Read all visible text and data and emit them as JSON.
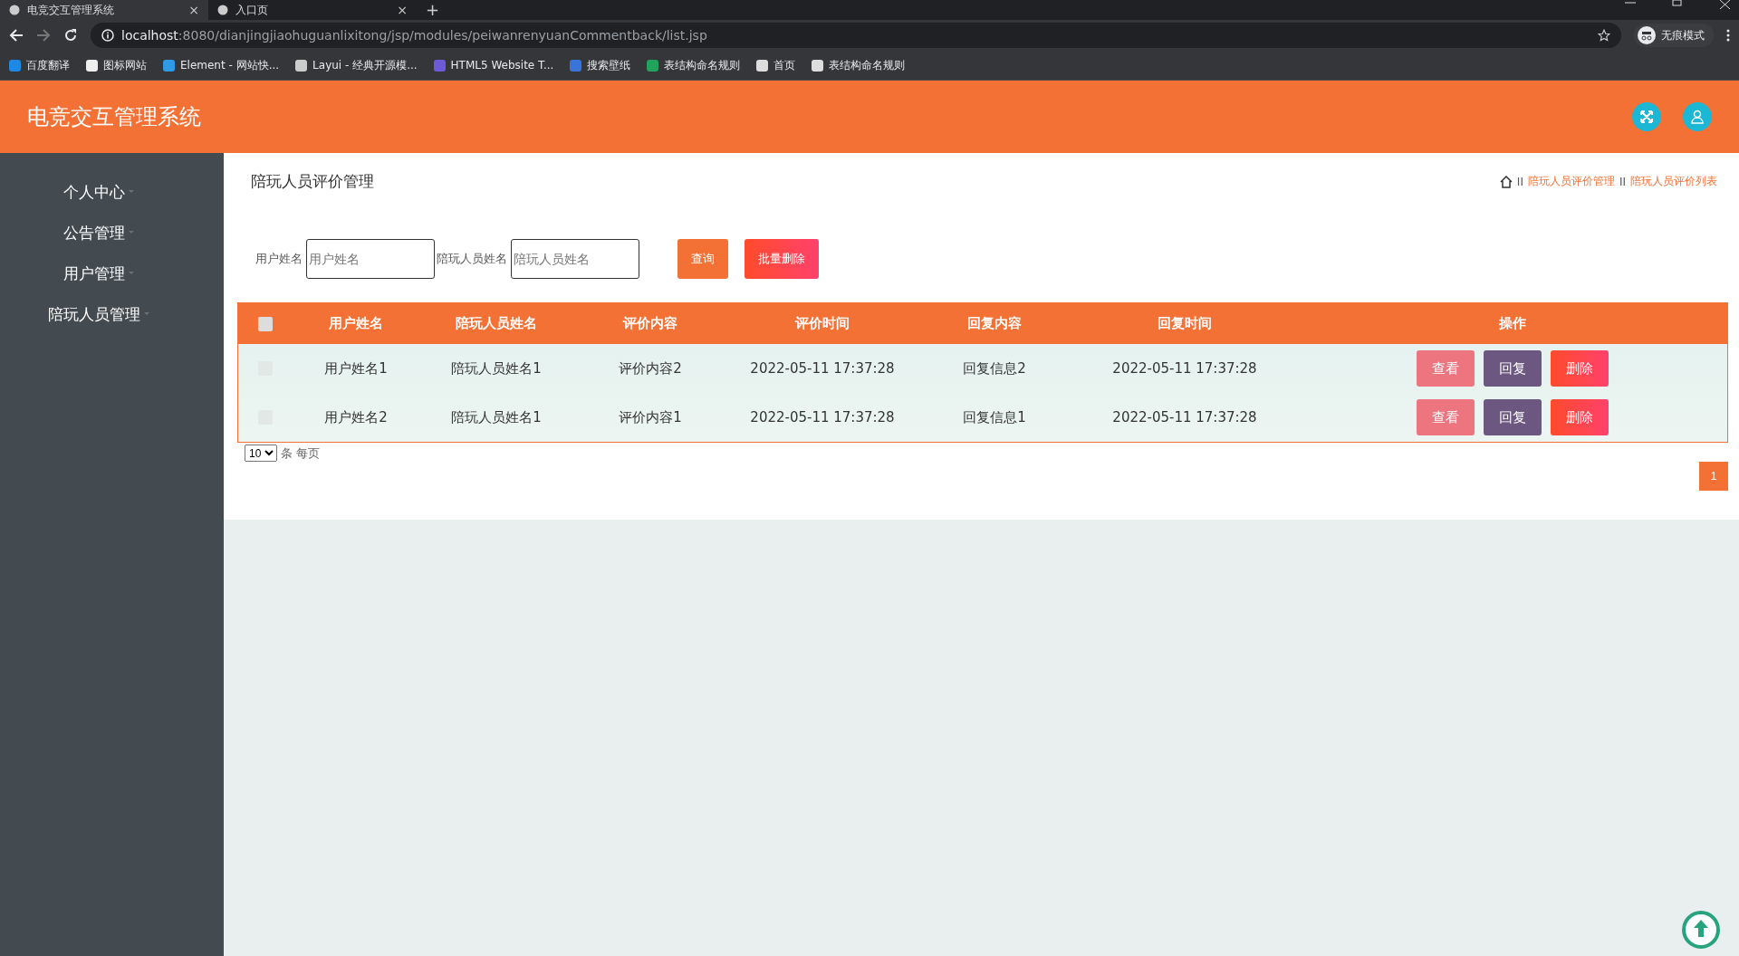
{
  "browser": {
    "tabs": [
      {
        "title": "电竞交互管理系统",
        "close": "×",
        "selected": true
      },
      {
        "title": "入口页",
        "close": "×",
        "selected": false
      }
    ],
    "new_tab": "+",
    "url_host": "localhost",
    "url_path": ":8080/dianjingjiaohuguanlixitong/jsp/modules/peiwanrenyuanCommentback/list.jsp",
    "profile": "无痕模式",
    "bookmarks": [
      "百度翻译",
      "图标网站",
      "Element - 网站快...",
      "Layui - 经典开源模...",
      "HTML5 Website T...",
      "搜索壁纸",
      "表结构命名规则",
      "首页",
      "表结构命名规则"
    ]
  },
  "app": {
    "title": "电竞交互管理系统"
  },
  "sidebar": {
    "items": [
      "个人中心",
      "公告管理",
      "用户管理",
      "陪玩人员管理"
    ]
  },
  "page": {
    "title": "陪玩人员评价管理",
    "breadcrumb": [
      {
        "separator": "II",
        "label": "陪玩人员评价管理"
      },
      {
        "separator": "II",
        "label": "陪玩人员评价列表"
      }
    ]
  },
  "search": {
    "fields": [
      {
        "label": "用户姓名",
        "placeholder": "用户姓名"
      },
      {
        "label": "陪玩人员姓名",
        "placeholder": "陪玩人员姓名"
      }
    ],
    "buttons": [
      {
        "label": "查询",
        "kind": "query"
      },
      {
        "label": "批量删除",
        "kind": "delete"
      }
    ]
  },
  "table": {
    "select_all": {
      "checked": false
    },
    "columns": [
      "用户姓名",
      "陪玩人员姓名",
      "评价内容",
      "评价时间",
      "回复内容",
      "回复时间",
      "操作"
    ],
    "rows": [
      {
        "checked": false,
        "cells": [
          "用户姓名1",
          "陪玩人员姓名1",
          "评价内容2",
          "2022-05-11 17:37:28",
          "回复信息2",
          "2022-05-11 17:37:28"
        ],
        "actions": [
          {
            "label": "查看",
            "kind": "view"
          },
          {
            "label": "回复",
            "kind": "reply"
          },
          {
            "label": "删除",
            "kind": "delete"
          }
        ]
      },
      {
        "checked": false,
        "cells": [
          "用户姓名2",
          "陪玩人员姓名1",
          "评价内容1",
          "2022-05-11 17:37:28",
          "回复信息1",
          "2022-05-11 17:37:28"
        ],
        "actions": [
          {
            "label": "查看",
            "kind": "view"
          },
          {
            "label": "回复",
            "kind": "reply"
          },
          {
            "label": "删除",
            "kind": "delete"
          }
        ]
      }
    ]
  },
  "pagination": {
    "page_size": "10",
    "page_size_label": "条 每页",
    "pages": [
      {
        "label": "1",
        "selected": true
      }
    ]
  }
}
